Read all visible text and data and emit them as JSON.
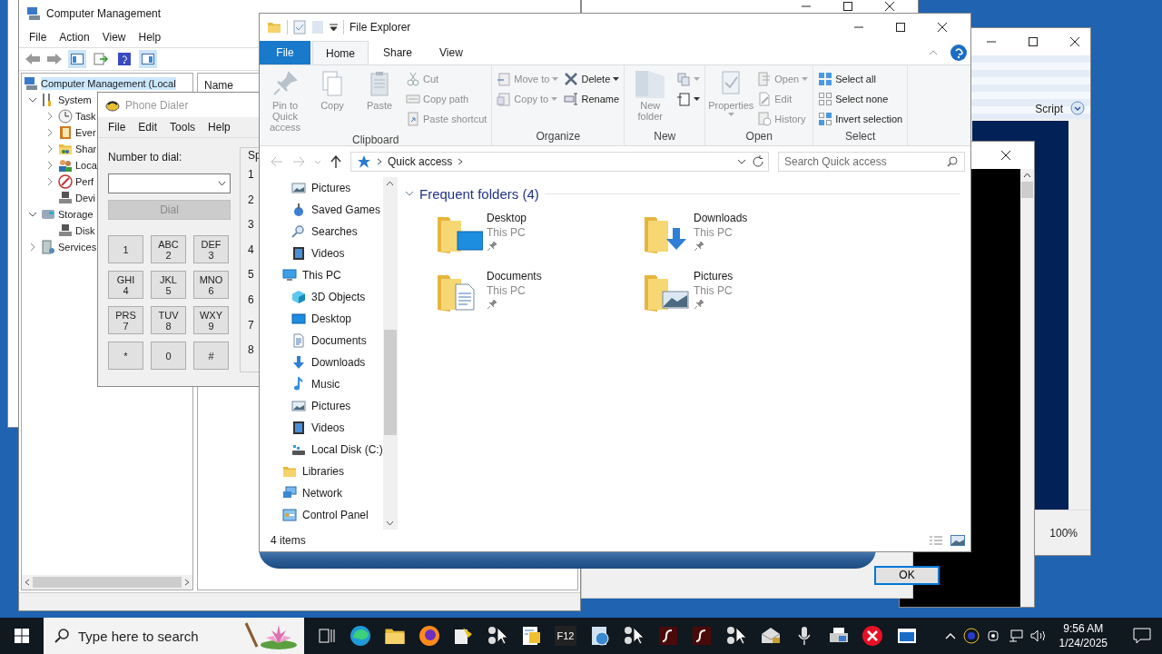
{
  "computer_management": {
    "title": "Computer Management",
    "menu": [
      "File",
      "Action",
      "View",
      "Help"
    ],
    "tree": [
      {
        "label": "Computer Management (Local",
        "kind": "computer",
        "leaf": true,
        "selected": true,
        "children": [
          {
            "label": "System",
            "kind": "tools",
            "leaf": false,
            "expanded": true,
            "selected": false,
            "children": [
              {
                "label": "Task",
                "kind": "clock",
                "leaf": false,
                "expanded": false,
                "selected": false
              },
              {
                "label": "Ever",
                "kind": "event",
                "leaf": false,
                "expanded": false,
                "selected": false
              },
              {
                "label": "Shar",
                "kind": "share",
                "leaf": false,
                "expanded": false,
                "selected": false
              },
              {
                "label": "Loca",
                "kind": "users",
                "leaf": false,
                "expanded": false,
                "selected": false
              },
              {
                "label": "Perf",
                "kind": "perf",
                "leaf": false,
                "expanded": false,
                "selected": false
              },
              {
                "label": "Devi",
                "kind": "device",
                "leaf": true,
                "selected": false
              }
            ]
          },
          {
            "label": "Storage",
            "kind": "storage",
            "leaf": false,
            "expanded": true,
            "selected": false,
            "children": [
              {
                "label": "Disk",
                "kind": "device",
                "leaf": true,
                "selected": false
              }
            ]
          },
          {
            "label": "Services",
            "kind": "services",
            "leaf": false,
            "expanded": false,
            "selected": false
          }
        ]
      }
    ],
    "column_1": "Name"
  },
  "phone_dialer": {
    "title": "Phone Dialer",
    "active": false,
    "menu": [
      "File",
      "Edit",
      "Tools",
      "Help"
    ],
    "number_label": "Number to dial:",
    "dial_button": {
      "label": "Dial",
      "disabled": true
    },
    "keys": [
      {
        "digit": "1"
      },
      {
        "letters": "ABC",
        "digit": "2"
      },
      {
        "letters": "DEF",
        "digit": "3"
      },
      {
        "letters": "GHI",
        "digit": "4"
      },
      {
        "letters": "JKL",
        "digit": "5"
      },
      {
        "letters": "MNO",
        "digit": "6"
      },
      {
        "letters": "PRS",
        "digit": "7"
      },
      {
        "letters": "TUV",
        "digit": "8"
      },
      {
        "letters": "WXY",
        "digit": "9"
      },
      {
        "digit": "*"
      },
      {
        "digit": "0"
      },
      {
        "digit": "#"
      }
    ],
    "speed_dial": {
      "heading": "Sp",
      "numbers": [
        "1",
        "2",
        "3",
        "4",
        "5",
        "6",
        "7",
        "8"
      ]
    }
  },
  "script_window": {
    "ribbon_label": "Script",
    "zoom": "100%"
  },
  "dialog": {
    "button": "OK"
  },
  "file_explorer": {
    "title": "File Explorer",
    "tabs": [
      {
        "label": "File",
        "kind": "file",
        "selected": false
      },
      {
        "label": "Home",
        "kind": "tab",
        "selected": true
      },
      {
        "label": "Share",
        "kind": "tab",
        "selected": false
      },
      {
        "label": "View",
        "kind": "tab",
        "selected": false
      }
    ],
    "ribbon": [
      {
        "label": "Clipboard",
        "items": [
          {
            "kind": "large",
            "label": "Pin to Quick access",
            "disabled": true,
            "dropdown": false
          },
          {
            "kind": "large",
            "label": "Copy",
            "disabled": true,
            "dropdown": false
          },
          {
            "kind": "large",
            "label": "Paste",
            "disabled": true,
            "dropdown": false
          },
          {
            "kind": "stack",
            "commands": [
              {
                "label": "Cut",
                "disabled": true,
                "dropdown": false
              },
              {
                "label": "Copy path",
                "disabled": true,
                "dropdown": false
              },
              {
                "label": "Paste shortcut",
                "disabled": true,
                "dropdown": false
              }
            ]
          }
        ]
      },
      {
        "label": "Organize",
        "items": [
          {
            "kind": "stack",
            "commands": [
              {
                "label": "Move to",
                "disabled": true,
                "dropdown": true
              },
              {
                "label": "Copy to",
                "disabled": true,
                "dropdown": true
              }
            ]
          },
          {
            "kind": "stack",
            "commands": [
              {
                "label": "Delete",
                "disabled": false,
                "dropdown": true
              },
              {
                "label": "Rename",
                "disabled": false,
                "dropdown": false
              }
            ]
          }
        ]
      },
      {
        "label": "New",
        "items": [
          {
            "kind": "large",
            "label": "New folder",
            "disabled": true,
            "dropdown": false
          },
          {
            "kind": "stack",
            "commands": [
              {
                "disabled": true,
                "dropdown": true
              },
              {
                "disabled": false,
                "dropdown": true
              }
            ]
          }
        ]
      },
      {
        "label": "Open",
        "items": [
          {
            "kind": "large",
            "label": "Properties",
            "disabled": true,
            "dropdown": true
          },
          {
            "kind": "stack",
            "commands": [
              {
                "label": "Open",
                "disabled": true,
                "dropdown": true
              },
              {
                "label": "Edit",
                "disabled": true,
                "dropdown": false
              },
              {
                "label": "History",
                "disabled": true,
                "dropdown": false
              }
            ]
          }
        ]
      },
      {
        "label": "Select",
        "items": [
          {
            "kind": "stack",
            "commands": [
              {
                "label": "Select all",
                "disabled": false,
                "dropdown": false
              },
              {
                "label": "Select none",
                "disabled": false,
                "dropdown": false
              },
              {
                "label": "Invert selection",
                "disabled": false,
                "dropdown": false
              }
            ]
          }
        ]
      }
    ],
    "address": "Quick access",
    "search_placeholder": "Search Quick access",
    "nav": [
      {
        "children": [
          {
            "label": "Pictures",
            "kind": "picture"
          },
          {
            "label": "Saved Games",
            "kind": "games"
          },
          {
            "label": "Searches",
            "kind": "search"
          },
          {
            "label": "Videos",
            "kind": "video"
          }
        ]
      },
      {
        "label": "This PC",
        "kind": "pc",
        "children": [
          {
            "label": "3D Objects",
            "kind": "cube"
          },
          {
            "label": "Desktop",
            "kind": "desktop"
          },
          {
            "label": "Documents",
            "kind": "document"
          },
          {
            "label": "Downloads",
            "kind": "download"
          },
          {
            "label": "Music",
            "kind": "music"
          },
          {
            "label": "Pictures",
            "kind": "picture"
          },
          {
            "label": "Videos",
            "kind": "video"
          },
          {
            "label": "Local Disk (C:)",
            "kind": "disk"
          }
        ]
      },
      {
        "label": "Libraries",
        "kind": "libraries"
      },
      {
        "label": "Network",
        "kind": "network"
      },
      {
        "label": "Control Panel",
        "kind": "panel"
      }
    ],
    "section": {
      "heading": "Frequent folders (4)",
      "expanded": true
    },
    "folders": [
      {
        "name": "Desktop",
        "location": "This PC",
        "kind": "desktop",
        "pinned": true
      },
      {
        "name": "Downloads",
        "location": "This PC",
        "kind": "download",
        "pinned": true
      },
      {
        "name": "Documents",
        "location": "This PC",
        "kind": "document",
        "pinned": true
      },
      {
        "name": "Pictures",
        "location": "This PC",
        "kind": "picture",
        "pinned": true
      }
    ],
    "status": "4 items"
  },
  "taskbar": {
    "search_placeholder": "Type here to search",
    "apps": [
      {
        "kind": "taskview"
      },
      {
        "kind": "edge"
      },
      {
        "kind": "explorer"
      },
      {
        "kind": "firefox"
      },
      {
        "kind": "tool"
      },
      {
        "kind": "cursor"
      },
      {
        "kind": "notes"
      },
      {
        "kind": "text",
        "label": "F12"
      },
      {
        "kind": "globe"
      },
      {
        "kind": "cursor"
      },
      {
        "kind": "flash"
      },
      {
        "kind": "flash"
      },
      {
        "kind": "cursor"
      },
      {
        "kind": "mail"
      },
      {
        "kind": "mic"
      },
      {
        "kind": "printer"
      },
      {
        "kind": "error"
      },
      {
        "kind": "window"
      }
    ],
    "time": "9:56 AM",
    "date": "1/24/2025"
  }
}
